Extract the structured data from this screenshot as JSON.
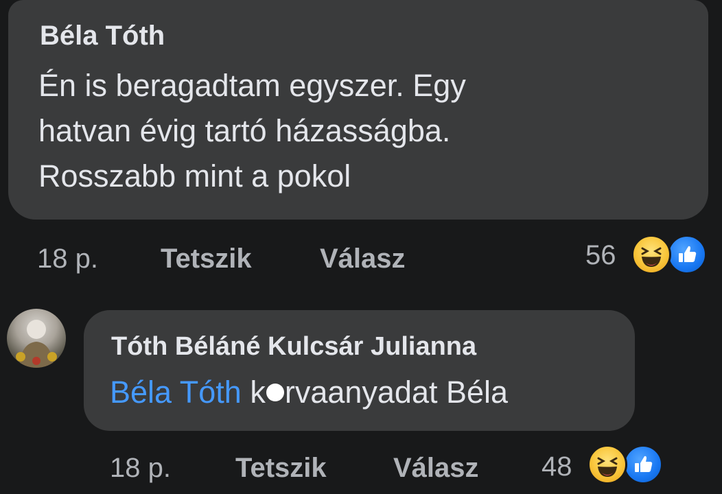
{
  "comments": [
    {
      "author": "Béla Tóth",
      "lines": [
        "Én is beragadtam egyszer. Egy",
        "hatvan évig tartó házasságba.",
        "Rosszabb mint a pokol"
      ],
      "time": "18 p.",
      "like_label": "Tetszik",
      "reply_label": "Válasz",
      "reaction_count": "56"
    },
    {
      "author": "Tóth Béláné Kulcsár Julianna",
      "mention": "Béla Tóth",
      "text_before_smudge": " k",
      "text_after_smudge": "rvaanyadat Béla",
      "time": "18 p.",
      "like_label": "Tetszik",
      "reply_label": "Válasz",
      "reaction_count": "48"
    }
  ],
  "icons": {
    "reaction_1": "haha-icon",
    "reaction_2": "like-icon",
    "avatar": "avatar"
  },
  "colors": {
    "background": "#18191a",
    "bubble": "#3a3b3c",
    "mention": "#4599ff",
    "meta": "#b0b3b8"
  }
}
